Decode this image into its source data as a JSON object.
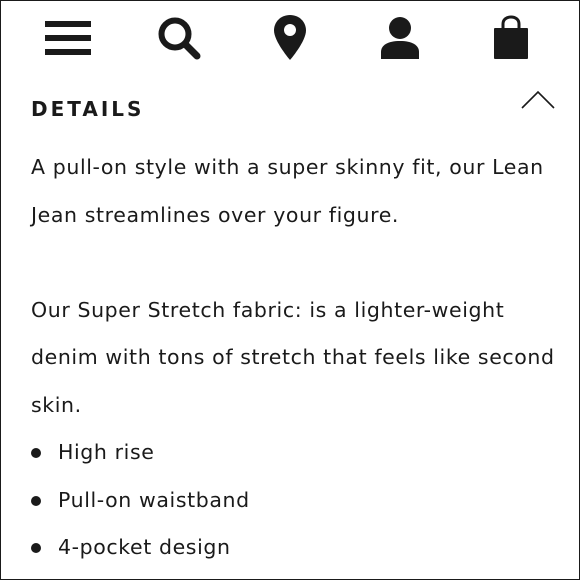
{
  "header": {
    "icons": {
      "menu": "hamburger-menu-icon",
      "search": "search-icon",
      "location": "location-pin-icon",
      "account": "user-icon",
      "bag": "shopping-bag-icon"
    },
    "icon_color": "#1a1a1a"
  },
  "details": {
    "title": "DETAILS",
    "state": "expanded",
    "toggle_icon": "chevron-up-icon",
    "paragraph_1": "A pull-on style with a super skinny fit, our Lean Jean streamlines over your figure.",
    "paragraph_2": "Our Super Stretch fabric: is a lighter-weight denim with tons of stretch that feels like second skin.",
    "features": [
      "High rise",
      "Pull-on waistband",
      "4-pocket design"
    ]
  }
}
